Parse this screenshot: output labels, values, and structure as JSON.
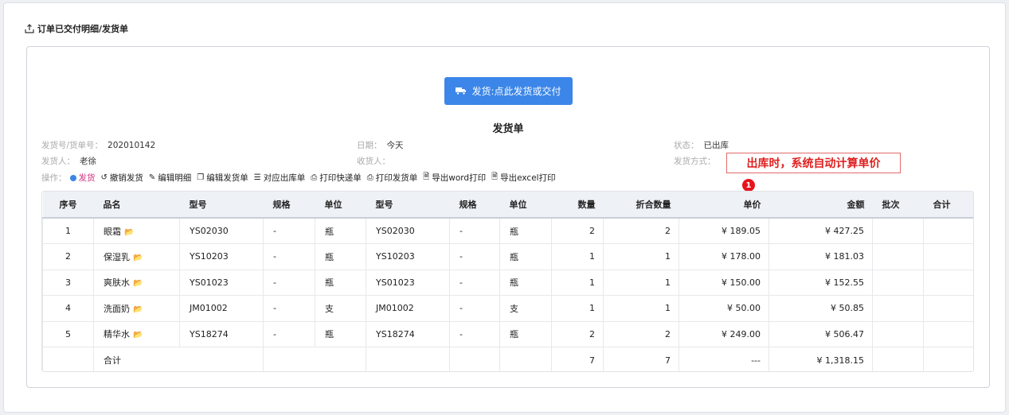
{
  "page": {
    "title": "订单已交付明细/发货单"
  },
  "ship_button": {
    "label": "发货:点此发货或交付"
  },
  "document": {
    "title": "发货单",
    "fields": {
      "order_no_label": "发货号/货单号：",
      "order_no": "202010142",
      "date_label": "日期：",
      "date": "今天",
      "status_label": "状态：",
      "status": "已出库",
      "shipper_label": "发货人：",
      "shipper": "老徐",
      "receiver_label": "收货人：",
      "receiver": "",
      "method_label": "发货方式：",
      "method": ""
    },
    "ops_label": "操作：",
    "ops": [
      {
        "label": "发货",
        "icon": "circle-arrow-icon"
      },
      {
        "label": "撤销发货",
        "icon": "undo-icon"
      },
      {
        "label": "编辑明细",
        "icon": "pencil-icon"
      },
      {
        "label": "编辑发货单",
        "icon": "copy-icon"
      },
      {
        "label": "对应出库单",
        "icon": "list-icon"
      },
      {
        "label": "打印快递单",
        "icon": "printer-icon"
      },
      {
        "label": "打印发货单",
        "icon": "printer-icon"
      },
      {
        "label": "导出word打印",
        "icon": "word-file-icon"
      },
      {
        "label": "导出excel打印",
        "icon": "excel-file-icon"
      }
    ]
  },
  "annotation": {
    "text": "出库时，系统自动计算单价",
    "badge": "1"
  },
  "table": {
    "headers": [
      "序号",
      "品名",
      "型号",
      "规格",
      "单位",
      "型号",
      "规格",
      "单位",
      "数量",
      "折合数量",
      "单价",
      "金额",
      "批次",
      "合计"
    ],
    "rows": [
      [
        "1",
        "眼霜",
        "YS02030",
        "-",
        "瓶",
        "YS02030",
        "-",
        "瓶",
        "2",
        "2",
        "¥ 189.05",
        "¥ 427.25",
        "",
        ""
      ],
      [
        "2",
        "保湿乳",
        "YS10203",
        "-",
        "瓶",
        "YS10203",
        "-",
        "瓶",
        "1",
        "1",
        "¥ 178.00",
        "¥ 181.03",
        "",
        ""
      ],
      [
        "3",
        "爽肤水",
        "YS01023",
        "-",
        "瓶",
        "YS01023",
        "-",
        "瓶",
        "1",
        "1",
        "¥ 150.00",
        "¥ 152.55",
        "",
        ""
      ],
      [
        "4",
        "洗面奶",
        "JM01002",
        "-",
        "支",
        "JM01002",
        "-",
        "支",
        "1",
        "1",
        "¥ 50.00",
        "¥ 50.85",
        "",
        ""
      ],
      [
        "5",
        "精华水",
        "YS18274",
        "-",
        "瓶",
        "YS18274",
        "-",
        "瓶",
        "2",
        "2",
        "¥ 249.00",
        "¥ 506.47",
        "",
        ""
      ]
    ],
    "total": {
      "label": "合计",
      "qty": "7",
      "conv_qty": "7",
      "unit_price": "---",
      "amount": "¥ 1,318.15"
    }
  },
  "colors": {
    "primary": "#3b86e8",
    "annotation": "#e02020",
    "active_op": "#d0317f"
  }
}
